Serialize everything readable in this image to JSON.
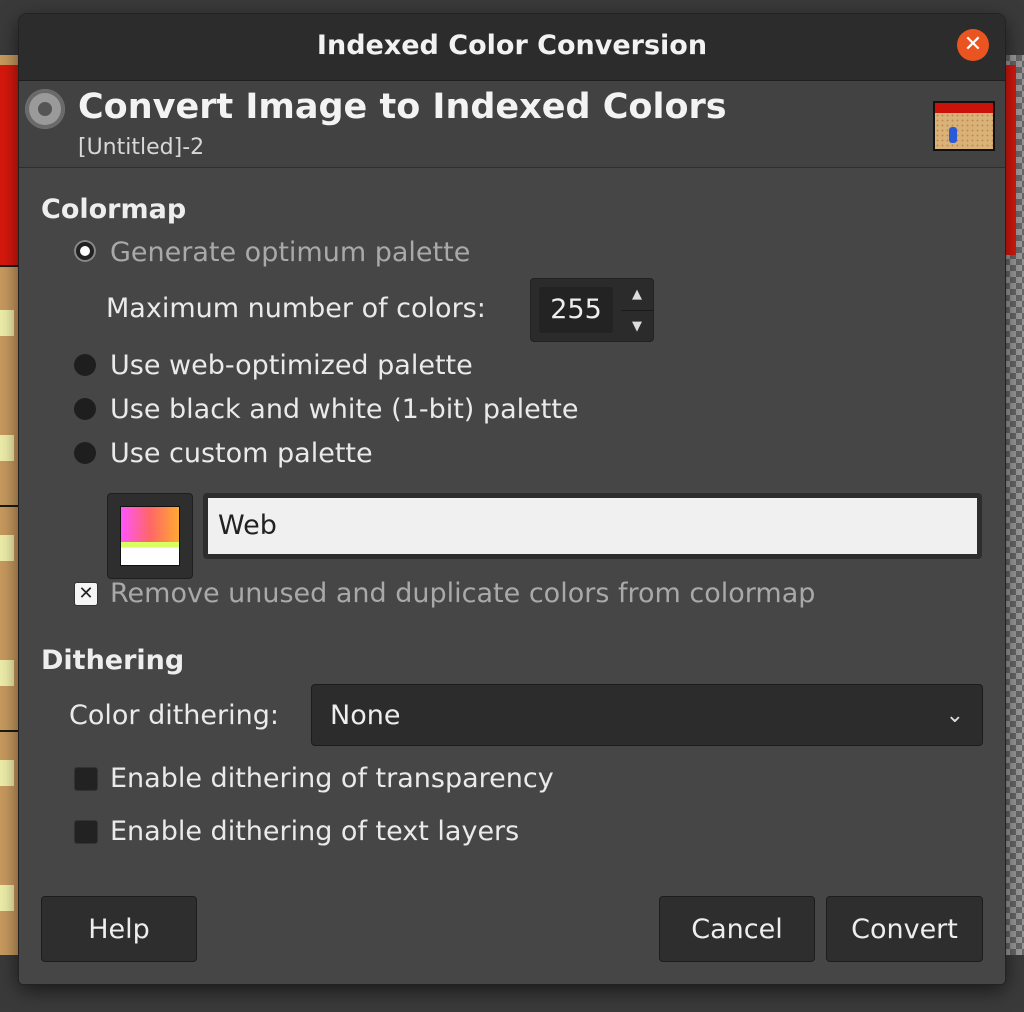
{
  "window": {
    "title": "Indexed Color Conversion"
  },
  "header": {
    "title": "Convert Image to Indexed Colors",
    "subtitle": "[Untitled]-2"
  },
  "colormap": {
    "heading": "Colormap",
    "options": [
      {
        "label": "Generate optimum palette",
        "selected": true
      },
      {
        "label": "Use web-optimized palette",
        "selected": false
      },
      {
        "label": "Use black and white (1-bit) palette",
        "selected": false
      },
      {
        "label": "Use custom palette",
        "selected": false
      }
    ],
    "max_colors_label": "Maximum number of colors:",
    "max_colors_value": "255",
    "custom_palette_name": "Web",
    "remove_unused_label": "Remove unused and duplicate colors from colormap",
    "remove_unused_checked": true
  },
  "dithering": {
    "heading": "Dithering",
    "color_dithering_label": "Color dithering:",
    "color_dithering_value": "None",
    "transparency_label": "Enable dithering of transparency",
    "text_layers_label": "Enable dithering of text layers"
  },
  "buttons": {
    "help": "Help",
    "cancel": "Cancel",
    "convert": "Convert"
  },
  "colors": {
    "accent_close": "#e95420",
    "dialog_bg": "#464646",
    "titlebar_bg": "#2c2c2c"
  }
}
